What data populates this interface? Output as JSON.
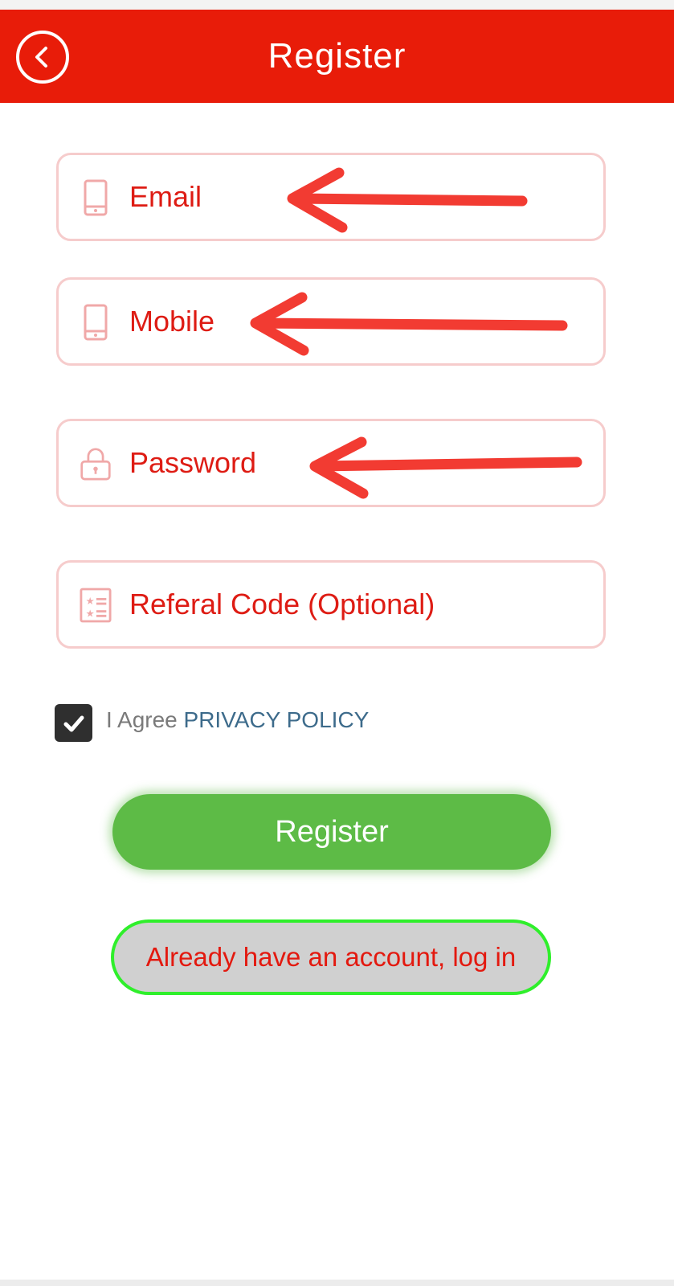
{
  "header": {
    "title": "Register",
    "background_color": "#e81c09",
    "back_icon": "chevron-left-circle-icon"
  },
  "form": {
    "fields": [
      {
        "placeholder": "Email",
        "icon": "smartphone-icon"
      },
      {
        "placeholder": "Mobile",
        "icon": "smartphone-icon"
      },
      {
        "placeholder": "Password",
        "icon": "lock-icon"
      },
      {
        "placeholder": "Referal Code (Optional)",
        "icon": "list-icon"
      }
    ],
    "field_text_color": "#de1c14",
    "field_border_color": "#f6cccc"
  },
  "agreement": {
    "checked": true,
    "prefix": "I Agree",
    "link": "PRIVACY POLICY"
  },
  "buttons": {
    "register": "Register",
    "register_color": "#5dbb46",
    "login": "Already have an account, log in",
    "login_border_color": "#2fef2b"
  },
  "annotations": {
    "arrow_color": "#f23b32"
  }
}
